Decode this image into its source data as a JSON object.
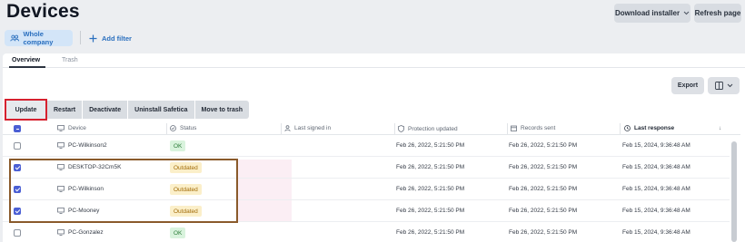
{
  "header": {
    "title": "Devices",
    "download_label": "Download installer",
    "refresh_label": "Refresh page"
  },
  "scope": {
    "label": "Whole company"
  },
  "filter": {
    "label": "Add filter"
  },
  "tabs": [
    {
      "label": "Overview"
    },
    {
      "label": "Trash"
    }
  ],
  "toolbar": {
    "export_label": "Export"
  },
  "actions": [
    {
      "label": "Update"
    },
    {
      "label": "Restart"
    },
    {
      "label": "Deactivate"
    },
    {
      "label": "Uninstall Safetica"
    },
    {
      "label": "Move to trash"
    }
  ],
  "columns": [
    {
      "label": "Device",
      "icon": "monitor-icon"
    },
    {
      "label": "Status",
      "icon": "status-icon"
    },
    {
      "label": "Last signed in",
      "icon": "user-icon"
    },
    {
      "label": "Protection updated",
      "icon": "shield-icon"
    },
    {
      "label": "Records sent",
      "icon": "calendar-icon"
    },
    {
      "label": "Last response",
      "icon": "clock-icon"
    }
  ],
  "sort_indicator": "↓",
  "rows": [
    {
      "device": "PC-Wilkinson2",
      "status": "OK",
      "status_type": "ok",
      "last_signed_in": "",
      "protection_updated": "Feb 26, 2022, 5:21:50 PM",
      "records_sent": "Feb 26, 2022, 5:21:50 PM",
      "last_response": "Feb 15, 2024, 9:36:48 AM",
      "checked": false
    },
    {
      "device": "DESKTOP-32Cm5K",
      "status": "Outdated",
      "status_type": "outdated",
      "last_signed_in": "",
      "protection_updated": "Feb 26, 2022, 5:21:50 PM",
      "records_sent": "Feb 26, 2022, 5:21:50 PM",
      "last_response": "Feb 15, 2024, 9:36:48 AM",
      "checked": true
    },
    {
      "device": "PC-Wilkinson",
      "status": "Outdated",
      "status_type": "outdated",
      "last_signed_in": "",
      "protection_updated": "Feb 26, 2022, 5:21:50 PM",
      "records_sent": "Feb 26, 2022, 5:21:50 PM",
      "last_response": "Feb 15, 2024, 9:36:48 AM",
      "checked": true
    },
    {
      "device": "PC-Mooney",
      "status": "Outdated",
      "status_type": "outdated",
      "last_signed_in": "",
      "protection_updated": "Feb 26, 2022, 5:21:50 PM",
      "records_sent": "Feb 26, 2022, 5:21:50 PM",
      "last_response": "Feb 15, 2024, 9:36:48 AM",
      "checked": true
    },
    {
      "device": "PC-Gonzalez",
      "status": "OK",
      "status_type": "ok",
      "last_signed_in": "",
      "protection_updated": "Feb 26, 2022, 5:21:50 PM",
      "records_sent": "Feb 26, 2022, 5:21:50 PM",
      "last_response": "Feb 15, 2024, 9:36:48 AM",
      "checked": false
    }
  ],
  "colors": {
    "accent": "#2a6fbe",
    "checkbox": "#4b5fd4",
    "highlight_red": "#d6212f",
    "highlight_brown": "#8a5a2b",
    "ok_bg": "#d9f3dd",
    "outdated_bg": "#fbefc9"
  }
}
